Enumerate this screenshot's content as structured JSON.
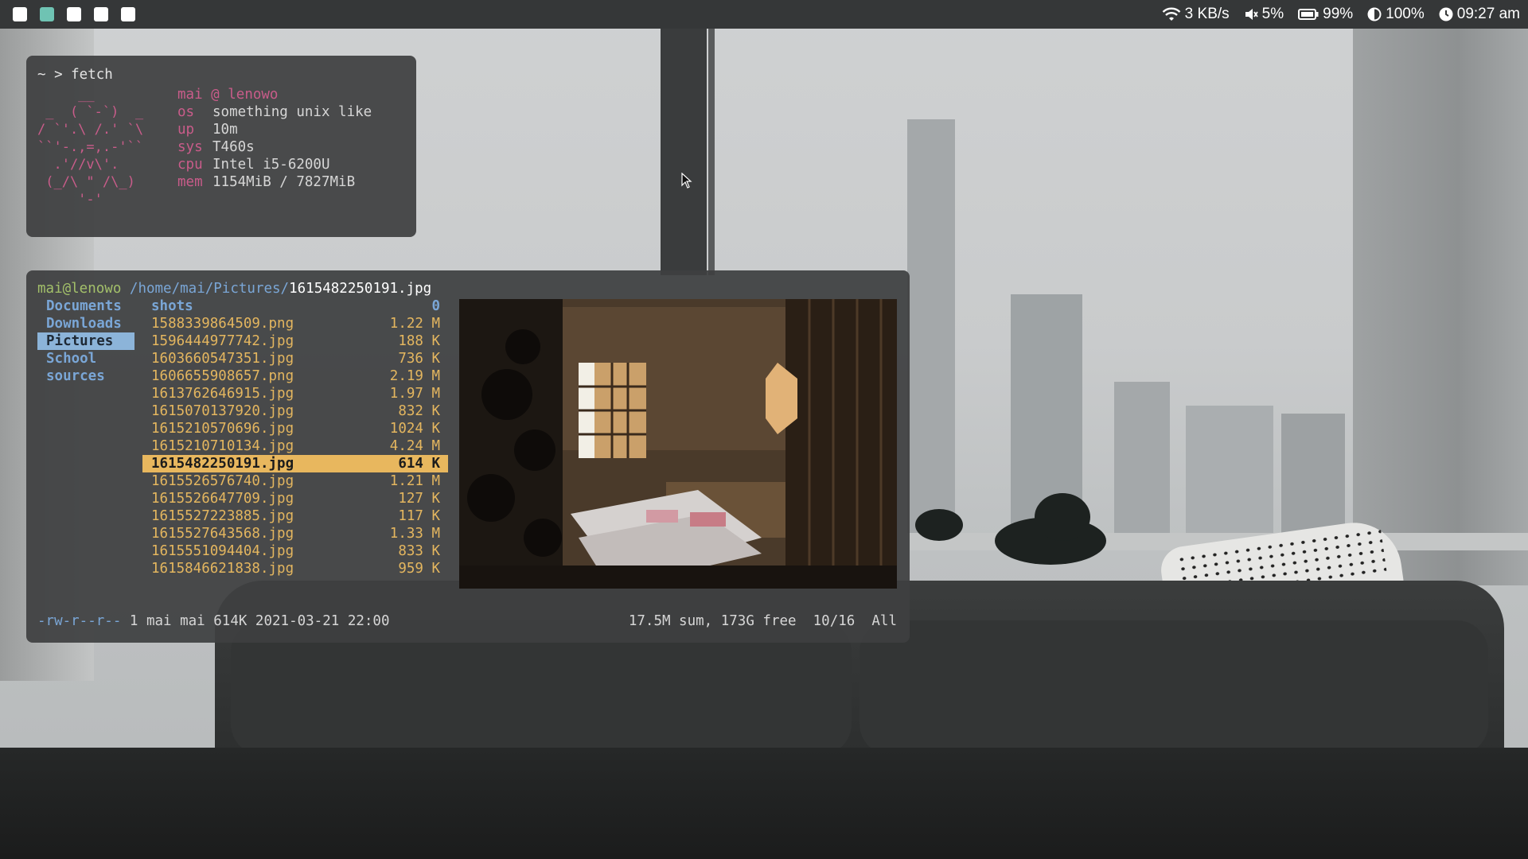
{
  "topbar": {
    "workspaces": [
      {
        "id": "1",
        "active": false
      },
      {
        "id": "2",
        "active": true
      },
      {
        "id": "3",
        "active": false
      },
      {
        "id": "4",
        "active": false
      },
      {
        "id": "5",
        "active": false
      }
    ],
    "accent_color": "#6fc3b3",
    "network": {
      "icon": "wifi-icon",
      "text": "3 KB/s"
    },
    "volume": {
      "icon": "speaker-muted-icon",
      "text": "5%"
    },
    "battery": {
      "icon": "battery-icon",
      "text": "99%"
    },
    "brightness": {
      "icon": "brightness-icon",
      "text": "100%"
    },
    "clock": {
      "icon": "clock-icon",
      "text": "09:27 am"
    }
  },
  "fetch": {
    "prompt": "~ > fetch",
    "ascii_art": "     __\n _  ( `-`)  _\n/ `'.\\ /.' `\\\n``'-.,=,.-'``\n  .'//v\\'.\n (_/\\ \" /\\_)\n     '-'",
    "user": "mai",
    "at": "@",
    "host": "lenowo",
    "rows": [
      {
        "key": "os",
        "value": "something unix like"
      },
      {
        "key": "up",
        "value": "10m"
      },
      {
        "key": "sys",
        "value": "T460s"
      },
      {
        "key": "cpu",
        "value": "Intel i5-6200U"
      },
      {
        "key": "mem",
        "value": "1154MiB / 7827MiB"
      }
    ]
  },
  "ranger": {
    "user_host": "mai@lenowo",
    "path": "/home/mai/Pictures/",
    "current_file": "1615482250191.jpg",
    "parent_dirs": [
      "Documents",
      "Downloads",
      "Pictures",
      "School",
      "sources"
    ],
    "selected_parent": 2,
    "files": [
      {
        "name": "shots",
        "size": "0",
        "dir": true
      },
      {
        "name": "1588339864509.png",
        "size": "1.22 M"
      },
      {
        "name": "1596444977742.jpg",
        "size": "188 K"
      },
      {
        "name": "1603660547351.jpg",
        "size": "736 K"
      },
      {
        "name": "1606655908657.png",
        "size": "2.19 M"
      },
      {
        "name": "1613762646915.jpg",
        "size": "1.97 M"
      },
      {
        "name": "1615070137920.jpg",
        "size": "832 K"
      },
      {
        "name": "1615210570696.jpg",
        "size": "1024 K"
      },
      {
        "name": "1615210710134.jpg",
        "size": "4.24 M"
      },
      {
        "name": "1615482250191.jpg",
        "size": "614 K",
        "selected": true
      },
      {
        "name": "1615526576740.jpg",
        "size": "1.21 M"
      },
      {
        "name": "1615526647709.jpg",
        "size": "127 K"
      },
      {
        "name": "1615527223885.jpg",
        "size": "117 K"
      },
      {
        "name": "1615527643568.jpg",
        "size": "1.33 M"
      },
      {
        "name": "1615551094404.jpg",
        "size": "833 K"
      },
      {
        "name": "1615846621838.jpg",
        "size": "959 K"
      }
    ],
    "status": {
      "permissions": "-rw-r--r--",
      "details": " 1 mai mai 614K 2021-03-21 22:00",
      "summary": "17.5M sum, 173G free  10/16  All"
    }
  }
}
